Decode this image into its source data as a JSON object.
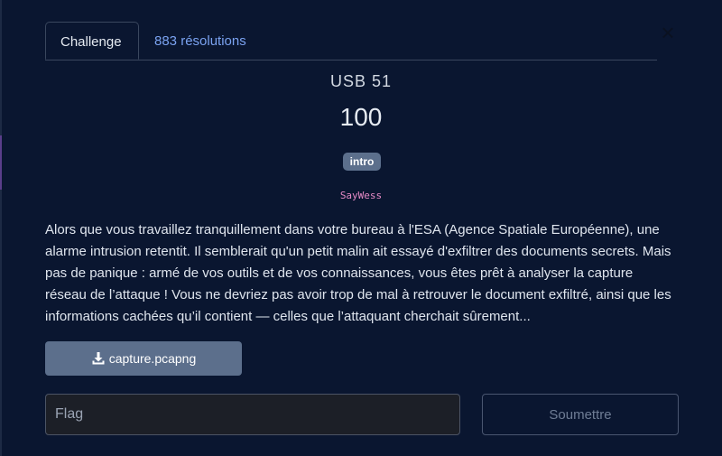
{
  "tabs": {
    "challenge_label": "Challenge",
    "solves_label": "883 résolutions"
  },
  "challenge": {
    "name": "USB 51",
    "points": "100",
    "tag": "intro",
    "author": "SayWess",
    "description": "Alors que vous travaillez tranquillement dans votre bureau à l'ESA (Agence Spatiale Européenne), une alarme intrusion retentit. Il semblerait qu'un petit malin ait essayé d'exfiltrer des documents secrets. Mais pas de panique : armé de vos outils et de vos connaissances, vous êtes prêt à analyser la capture réseau de l’attaque ! Vous ne devriez pas avoir trop de mal à retrouver le document exfiltré, ainsi que les informations cachées qu’il contient — celles que l’attaquant cherchait sûrement..."
  },
  "download": {
    "filename": "capture.pcapng",
    "icon": "download-icon"
  },
  "form": {
    "flag_placeholder": "Flag",
    "flag_value": "",
    "submit_label": "Soumettre"
  },
  "close": {
    "glyph": "×",
    "icon": "close-icon"
  },
  "colors": {
    "background": "#0a1630",
    "accent_link": "#7aa2f0",
    "tag_bg": "#5c6f8c",
    "author": "#e58ac6"
  }
}
